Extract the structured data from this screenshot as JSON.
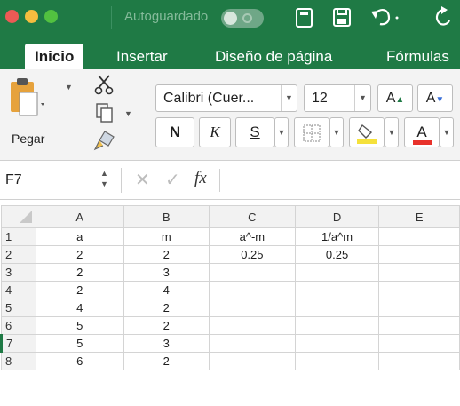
{
  "titlebar": {
    "autosave_label": "Autoguardado",
    "icons": [
      "notebook-icon",
      "save-icon",
      "undo-icon",
      "redo-icon"
    ]
  },
  "ribbon_tabs": [
    "Inicio",
    "Insertar",
    "Diseño de página",
    "Fórmulas"
  ],
  "ribbon": {
    "paste_label": "Pegar",
    "font_name": "Calibri (Cuer...",
    "font_size": "12",
    "grow_font": "A",
    "shrink_font": "A",
    "bold": "N",
    "italic": "K",
    "underline": "S",
    "font_color_letter": "A",
    "colors": {
      "highlight": "#f5e13b",
      "font_color": "#e8322b"
    }
  },
  "formula_bar": {
    "cell_reference": "F7",
    "cancel_symbol": "✕",
    "enter_symbol": "✓",
    "fx_symbol": "fx",
    "content": ""
  },
  "grid": {
    "columns": [
      "A",
      "B",
      "C",
      "D",
      "E"
    ],
    "rows": [
      {
        "num": "1",
        "cells": [
          "a",
          "m",
          "a^-m",
          "1/a^m",
          ""
        ]
      },
      {
        "num": "2",
        "cells": [
          "2",
          "2",
          "0.25",
          "0.25",
          ""
        ]
      },
      {
        "num": "3",
        "cells": [
          "2",
          "3",
          "",
          "",
          ""
        ]
      },
      {
        "num": "4",
        "cells": [
          "2",
          "4",
          "",
          "",
          ""
        ]
      },
      {
        "num": "5",
        "cells": [
          "4",
          "2",
          "",
          "",
          ""
        ]
      },
      {
        "num": "6",
        "cells": [
          "5",
          "2",
          "",
          "",
          ""
        ]
      },
      {
        "num": "7",
        "cells": [
          "5",
          "3",
          "",
          "",
          ""
        ]
      },
      {
        "num": "8",
        "cells": [
          "6",
          "2",
          "",
          "",
          ""
        ]
      }
    ]
  },
  "colors": {
    "excel_green": "#1f7a45"
  }
}
